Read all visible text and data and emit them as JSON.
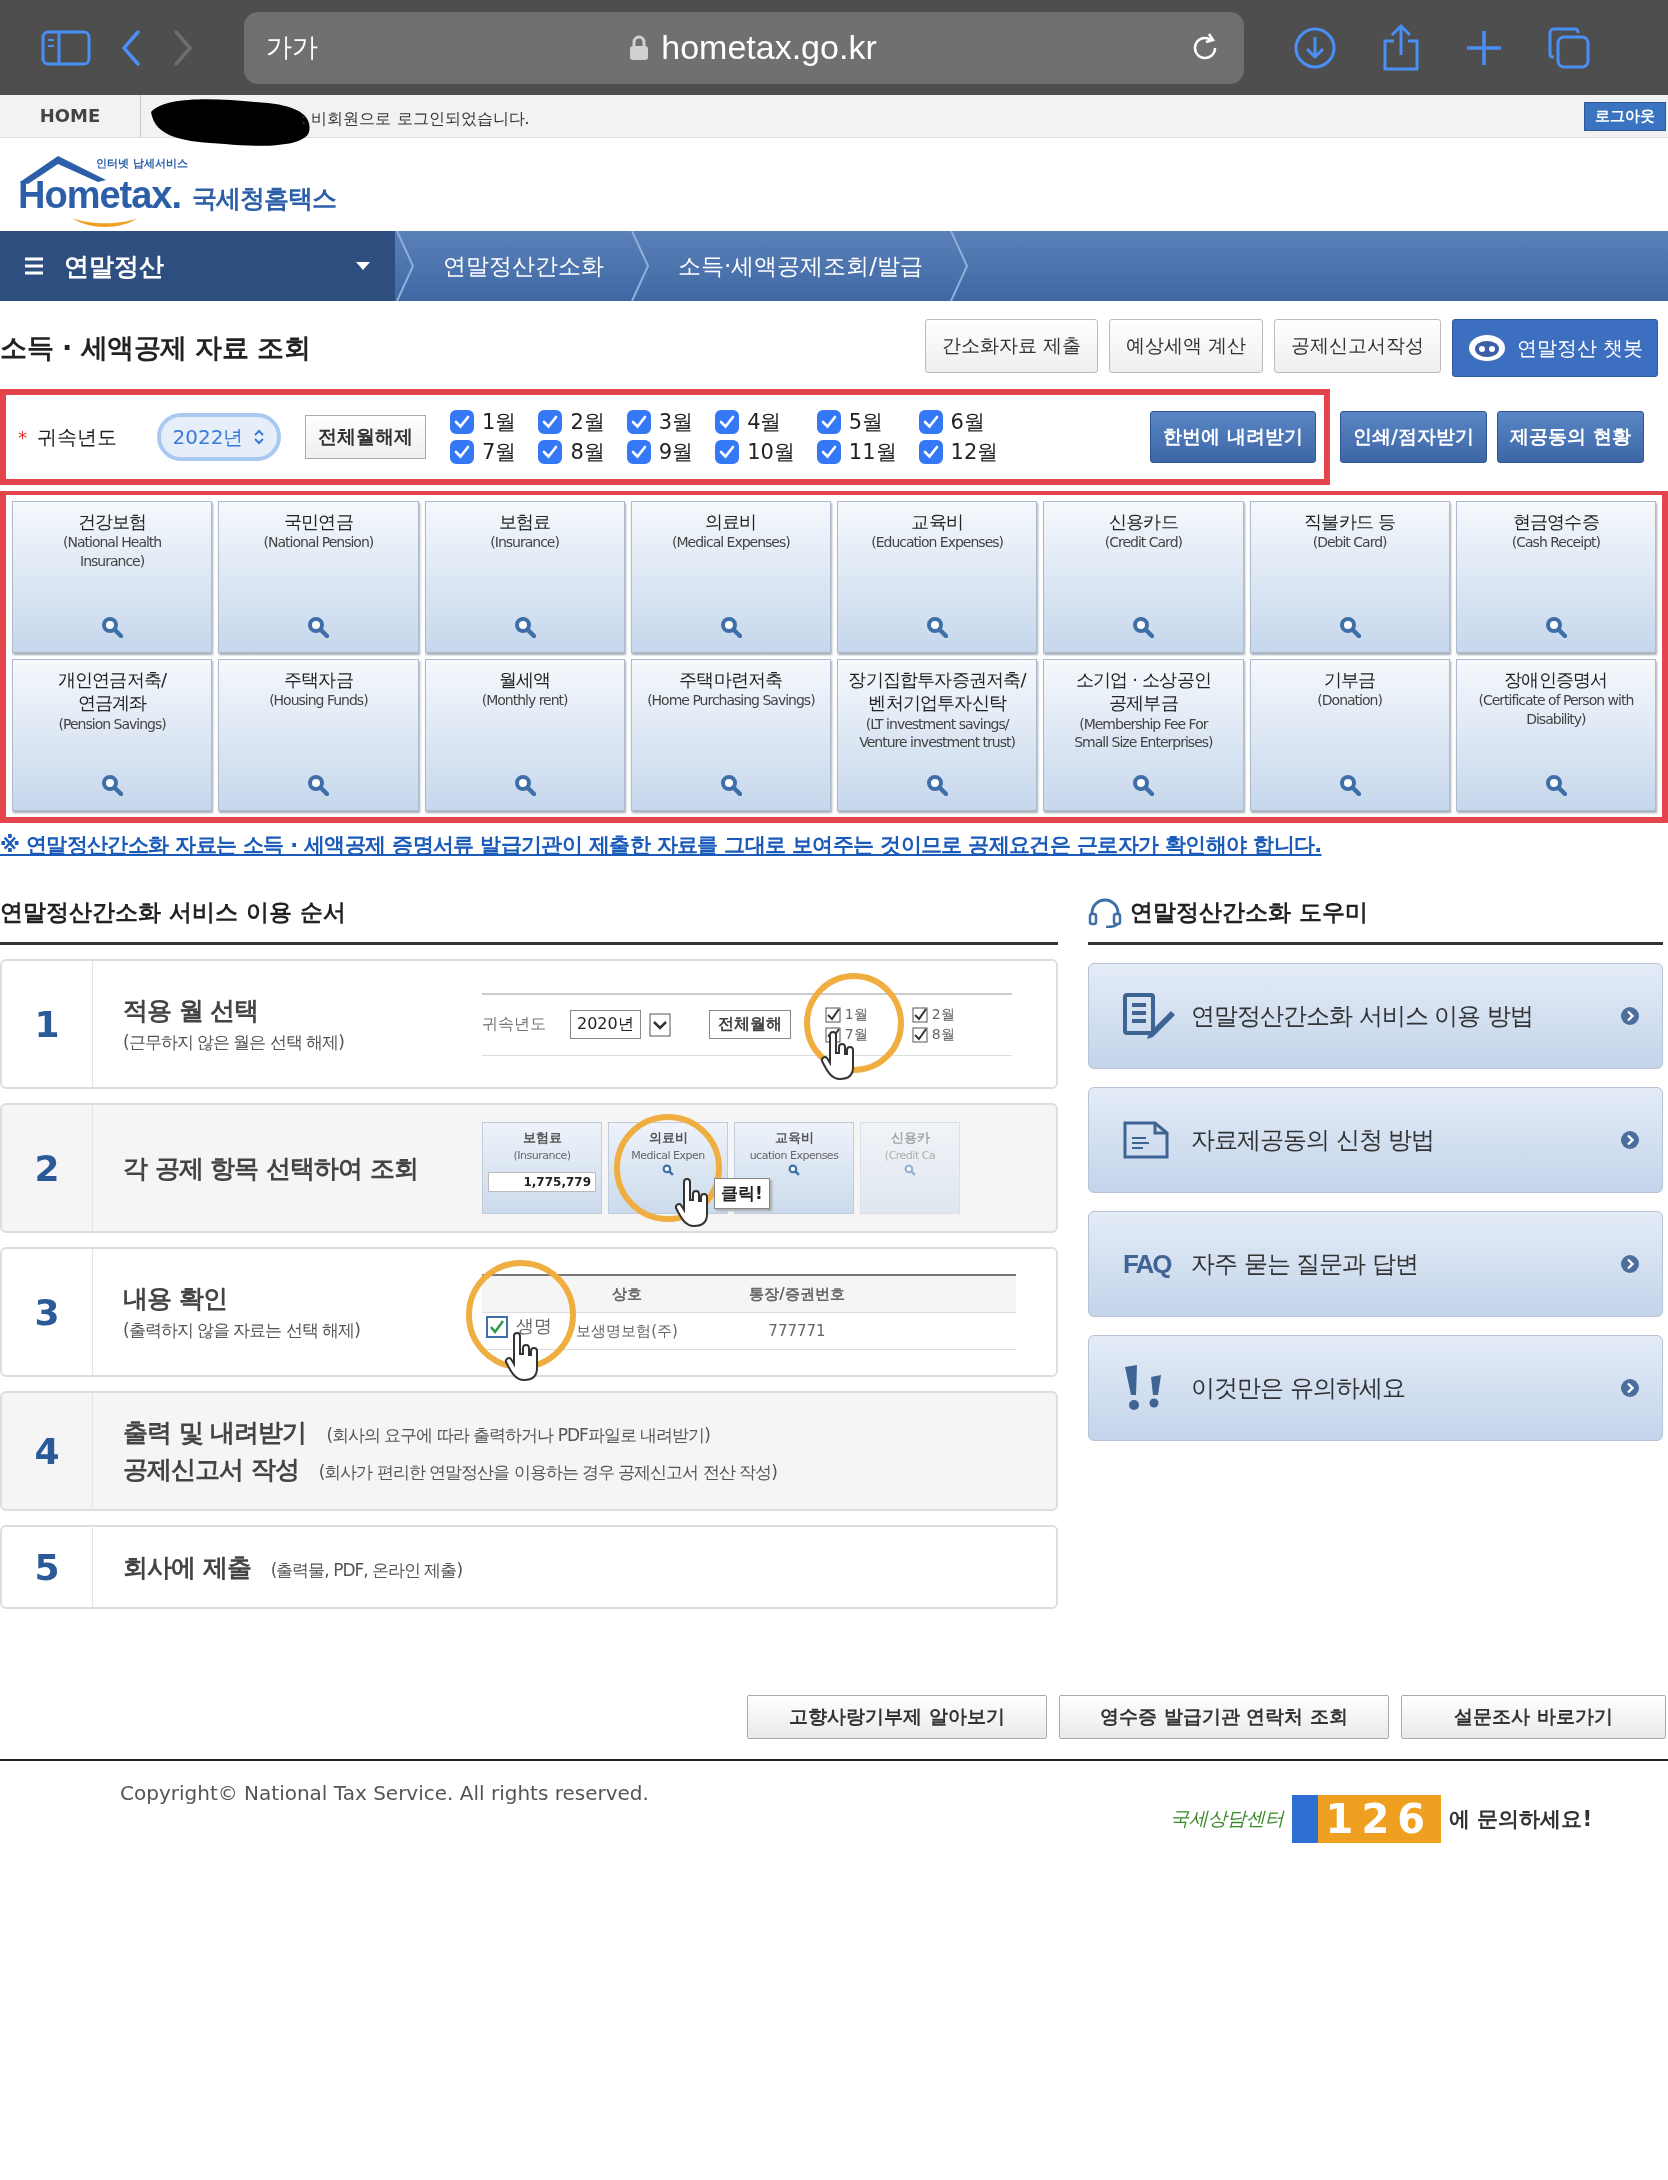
{
  "browser": {
    "text_size": "가가",
    "address": "hometax.go.kr"
  },
  "top_bar": {
    "home": "HOME",
    "login_status": ": 비회원으로 로그인되었습니다.",
    "logout": "로그아웃"
  },
  "logo": {
    "tagline": "인터넷 납세서비스",
    "wordmark": "Hometax.",
    "korean_name": "국세청홈택스"
  },
  "nav": {
    "menu": "연말정산",
    "breadcrumbs": [
      "연말정산간소화",
      "소득·세액공제조회/발급"
    ]
  },
  "page_title": "소득 · 세액공제 자료 조회",
  "header_buttons": [
    {
      "label": "간소화자료 제출",
      "kind": "plain"
    },
    {
      "label": "예상세액 계산",
      "kind": "plain"
    },
    {
      "label": "공제신고서작성",
      "kind": "plain"
    },
    {
      "label": "연말정산 챗봇",
      "kind": "chatbot"
    }
  ],
  "filter": {
    "required_mark": "*",
    "year_label": "귀속년도",
    "year": "2022년",
    "clear_button": "전체월해제",
    "months": [
      {
        "label": "1월",
        "checked": true
      },
      {
        "label": "2월",
        "checked": true
      },
      {
        "label": "3월",
        "checked": true
      },
      {
        "label": "4월",
        "checked": true
      },
      {
        "label": "5월",
        "checked": true
      },
      {
        "label": "6월",
        "checked": true
      },
      {
        "label": "7월",
        "checked": true
      },
      {
        "label": "8월",
        "checked": true
      },
      {
        "label": "9월",
        "checked": true
      },
      {
        "label": "10월",
        "checked": true
      },
      {
        "label": "11월",
        "checked": true
      },
      {
        "label": "12월",
        "checked": true
      }
    ],
    "download_button": "한번에 내려받기"
  },
  "action_buttons": [
    "인쇄/점자받기",
    "제공동의 현황"
  ],
  "categories": [
    {
      "title": "건강보험",
      "subtitle": "(National Health\nInsurance)"
    },
    {
      "title": "국민연금",
      "subtitle": "(National Pension)"
    },
    {
      "title": "보험료",
      "subtitle": "(Insurance)"
    },
    {
      "title": "의료비",
      "subtitle": "(Medical Expenses)"
    },
    {
      "title": "교육비",
      "subtitle": "(Education Expenses)"
    },
    {
      "title": "신용카드",
      "subtitle": "(Credit Card)"
    },
    {
      "title": "직불카드 등",
      "subtitle": "(Debit Card)"
    },
    {
      "title": "현금영수증",
      "subtitle": "(Cash Receipt)"
    },
    {
      "title": "개인연금저축/\n연금계좌",
      "subtitle": "(Pension Savings)"
    },
    {
      "title": "주택자금",
      "subtitle": "(Housing Funds)"
    },
    {
      "title": "월세액",
      "subtitle": "(Monthly rent)"
    },
    {
      "title": "주택마련저축",
      "subtitle": "(Home Purchasing Savings)"
    },
    {
      "title": "장기집합투자증권저축/\n벤처기업투자신탁",
      "subtitle": "(LT investment savings/\nVenture investment trust)"
    },
    {
      "title": "소기업 · 소상공인\n공제부금",
      "subtitle": "(Membership Fee For\nSmall Size Enterprises)"
    },
    {
      "title": "기부금",
      "subtitle": "(Donation)"
    },
    {
      "title": "장애인증명서",
      "subtitle": "(Certificate of Person with\nDisability)"
    }
  ],
  "notice": "※ 연말정산간소화 자료는 소득 · 세액공제 증명서류 발급기관이 제출한 자료를 그대로 보여주는 것이므로 공제요건은 근로자가 확인해야 합니다.",
  "steps_section": {
    "title": "연말정산간소화 서비스 이용 순서",
    "steps": [
      {
        "number": "1",
        "kind": "stacked",
        "lines": [
          {
            "title": "적용 월 선택",
            "note": "(근무하지 않은 월은 선택 해제)"
          }
        ],
        "illustration": {
          "kind": "month_picker",
          "label": "귀속년도",
          "year": "2020년",
          "button": "전체월해",
          "months": [
            {
              "label": "1월",
              "checked": true
            },
            {
              "label": "7월",
              "checked": true
            },
            {
              "label": "2월",
              "checked": true
            },
            {
              "label": "8월",
              "checked": true
            }
          ]
        }
      },
      {
        "number": "2",
        "kind": "stacked",
        "lines": [
          {
            "title": "각 공제 항목 선택하여 조회"
          }
        ],
        "illustration": {
          "kind": "card_row",
          "callout": "클릭!",
          "cards": [
            {
              "title": "보험료",
              "subtitle": "(Insurance)",
              "amount": "1,775,779"
            },
            {
              "title": "의료비",
              "subtitle": "Medical Expen"
            },
            {
              "title": "교육비",
              "subtitle": "ucation Expenses"
            },
            {
              "title": "신용카",
              "subtitle": "(Credit Ca"
            }
          ]
        }
      },
      {
        "number": "3",
        "kind": "stacked",
        "lines": [
          {
            "title": "내용 확인",
            "note": "(출력하지 않을 자료는 선택 해제)"
          }
        ],
        "illustration": {
          "kind": "table",
          "zoom_text": "생명",
          "columns": [
            "상호",
            "통장/증권번호"
          ],
          "rows": [
            {
              "name": "보생명보험(주)",
              "account": "777771",
              "checked": true
            }
          ]
        }
      },
      {
        "number": "4",
        "kind": "inline",
        "lines": [
          {
            "title": "출력 및 내려받기",
            "note": "(회사의 요구에 따라 출력하거나 PDF파일로 내려받기)"
          },
          {
            "title": "공제신고서 작성",
            "note": "(회사가 편리한 연말정산을 이용하는 경우 공제신고서 전산 작성)"
          }
        ]
      },
      {
        "number": "5",
        "kind": "inline",
        "lines": [
          {
            "title": "회사에 제출",
            "note": "(출력물, PDF, 온라인 제출)"
          }
        ]
      }
    ]
  },
  "helper": {
    "title": "연말정산간소화 도우미",
    "items": [
      {
        "label": "연말정산간소화 서비스 이용 방법",
        "kind": "guide"
      },
      {
        "label": "자료제공동의 신청 방법",
        "kind": "form"
      },
      {
        "label": "자주 묻는 질문과 답변",
        "kind": "faq",
        "icon_text": "FAQ"
      },
      {
        "label": "이것만은 유의하세요",
        "kind": "caution"
      }
    ]
  },
  "footer_buttons": [
    "고향사랑기부제 알아보기",
    "영수증 발급기관 연락처 조회",
    "설문조사 바로가기"
  ],
  "copyright": "Copyright© National Tax Service. All rights reserved.",
  "call_center": {
    "name": "국세상담센터",
    "number": "126",
    "suffix": "에 문의하세요!"
  }
}
